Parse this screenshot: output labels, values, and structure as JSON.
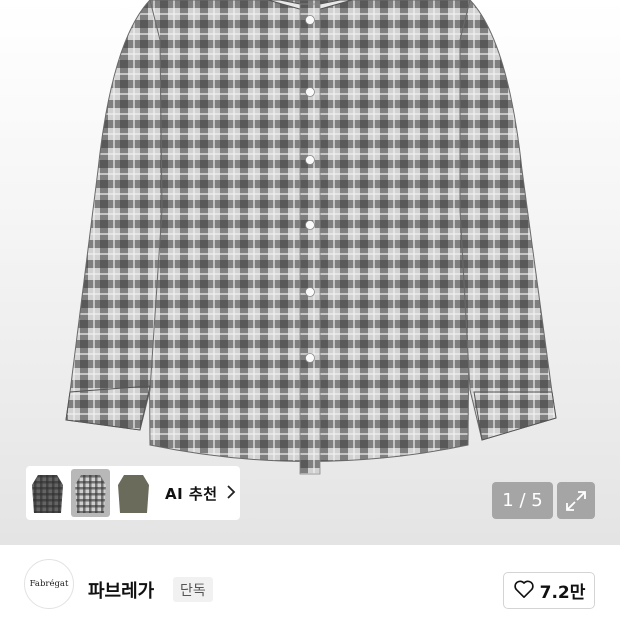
{
  "product_gallery": {
    "image_description": "gray-black-checked-long-sleeve-shirt",
    "ai_recommend": {
      "label": "AI 추천",
      "thumbnail_icons": [
        "black-check-shirt-thumb",
        "gray-check-shirt-thumb",
        "khaki-shirt-thumb"
      ]
    },
    "pager": {
      "text": "1 / 5"
    },
    "expand_icon": "expand-arrows-icon"
  },
  "brand": {
    "logo_text": "Fabrégat",
    "name": "파브레가",
    "badge": "단독",
    "like": {
      "icon": "heart-outline-icon",
      "count": "7.2만"
    }
  },
  "colors": {
    "hero_bg": "#e8e8e8",
    "pager_bg": "#969696",
    "badge_bg": "#f1f1f1",
    "text_primary": "#111111"
  }
}
